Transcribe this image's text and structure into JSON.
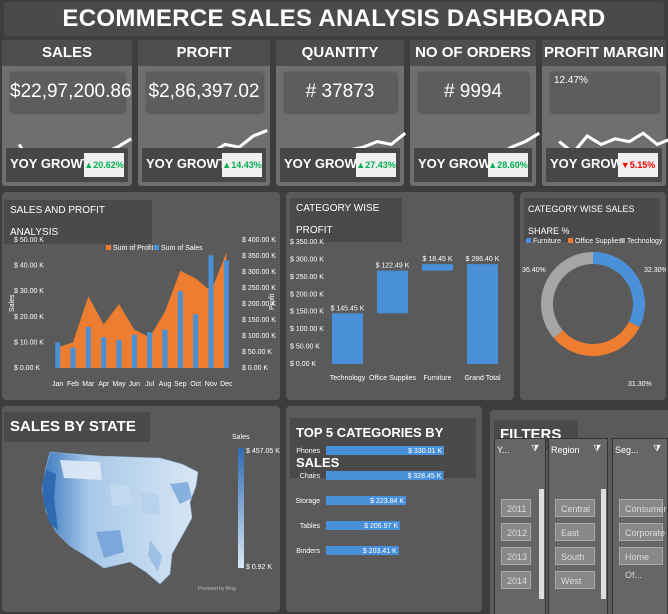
{
  "title": "ECOMMERCE SALES ANALYSIS DASHBOARD",
  "colors": {
    "orange": "#ed7d31",
    "blue": "#4a90d9",
    "gray": "#a5a5a5",
    "green": "#00b050",
    "red": "#ff0000"
  },
  "kpis": [
    {
      "label": "SALES",
      "value": "$22,97,200.86",
      "yoy_label": "YOY GROWTH",
      "yoy_value": "▲20.62%",
      "yoy_color": "#00b050"
    },
    {
      "label": "PROFIT",
      "value": "$2,86,397.02",
      "yoy_label": "YOY GROWTH",
      "yoy_value": "▲14.43%",
      "yoy_color": "#00b050"
    },
    {
      "label": "QUANTITY",
      "value": "# 37873",
      "yoy_label": "YOY GROWTH",
      "yoy_value": "▲27.43%",
      "yoy_color": "#00b050"
    },
    {
      "label": "NO OF ORDERS",
      "value": "# 9994",
      "yoy_label": "YOY GROWTH",
      "yoy_value": "▲28.60%",
      "yoy_color": "#00b050"
    },
    {
      "label": "PROFIT MARGIN",
      "value": "12.47%",
      "yoy_label": "YOY GROWTH",
      "yoy_value": "▼5.15%",
      "yoy_color": "#ff0000"
    }
  ],
  "sales_profit": {
    "title": "SALES AND PROFIT ANALYSIS",
    "chart_data": {
      "type": "bar",
      "categories": [
        "Jan",
        "Feb",
        "Mar",
        "Apr",
        "May",
        "Jun",
        "Jul",
        "Aug",
        "Sep",
        "Oct",
        "Nov",
        "Dec"
      ],
      "series": [
        {
          "name": "Sum of Profit",
          "type": "area",
          "values": [
            8,
            10,
            28,
            17,
            25,
            15,
            12,
            22,
            38,
            35,
            30,
            45
          ]
        },
        {
          "name": "Sum of Sales",
          "type": "bar",
          "values": [
            10,
            8,
            16,
            12,
            11,
            13,
            14,
            15,
            30,
            21,
            44,
            42
          ]
        }
      ],
      "ylabel": "Sales",
      "ylabel2": "Profit",
      "yticks_left": [
        "$ 50.00 K",
        "$ 40.00 K",
        "$ 30.00 K",
        "$ 20.00 K",
        "$ 10.00 K",
        "$ 0.00 K"
      ],
      "yticks_right": [
        "$ 400.00 K",
        "$ 350.00 K",
        "$ 300.00 K",
        "$ 250.00 K",
        "$ 200.00 K",
        "$ 150.00 K",
        "$ 100.00 K",
        "$ 50.00 K",
        "$ 0.00 K"
      ],
      "ylim": [
        0,
        50
      ]
    }
  },
  "category_profit": {
    "title": "CATEGORY WISE PROFIT",
    "chart_data": {
      "type": "bar",
      "categories": [
        "Technology",
        "Office Supplies",
        "Furniture",
        "Grand Total"
      ],
      "values": [
        145.45,
        122.49,
        18.45,
        286.4
      ],
      "labels": [
        "$ 145.45 K",
        "$ 122.49 K",
        "$ 18.45 K",
        "$ 286.40 K"
      ],
      "yticks": [
        "$ 350.00 K",
        "$ 300.00 K",
        "$ 250.00 K",
        "$ 200.00 K",
        "$ 150.00 K",
        "$ 100.00 K",
        "$ 50.00 K",
        "$ 0.00 K"
      ],
      "ylim": [
        0,
        350
      ]
    }
  },
  "sales_share": {
    "title": "CATEGORY WISE SALES SHARE %",
    "chart_data": {
      "type": "pie",
      "categories": [
        "Furniture",
        "Office Supplies",
        "Technology"
      ],
      "values": [
        32.3,
        31.3,
        36.4
      ],
      "labels": [
        "32.30%",
        "31.30%",
        "36.40%"
      ],
      "colors": [
        "#4a90d9",
        "#ed7d31",
        "#a5a5a5"
      ]
    }
  },
  "sales_by_state": {
    "title": "SALES BY STATE",
    "legend_title": "Sales",
    "legend_max": "$ 457.05 K",
    "legend_min": "$ 0.92 K",
    "credit": "Powered by Bing"
  },
  "top5": {
    "title": "TOP 5 CATEGORIES BY SALES",
    "chart_data": {
      "type": "bar",
      "categories": [
        "Phones",
        "Chairs",
        "Storage",
        "Tables",
        "Binders"
      ],
      "values": [
        330.01,
        328.45,
        223.84,
        206.97,
        203.41
      ],
      "labels": [
        "$ 330.01 K",
        "$ 328.45 K",
        "$ 223.84 K",
        "$ 206.97 K",
        "$ 203.41 K"
      ]
    }
  },
  "filters": {
    "title": "FILTERS",
    "year": {
      "header": "Y...",
      "items": [
        "2011",
        "2012",
        "2013",
        "2014"
      ]
    },
    "region": {
      "header": "Region",
      "items": [
        "Central",
        "East",
        "South",
        "West"
      ]
    },
    "segment": {
      "header": "Seg...",
      "items": [
        "Consumer",
        "Corporate",
        "Home Of..."
      ]
    }
  }
}
